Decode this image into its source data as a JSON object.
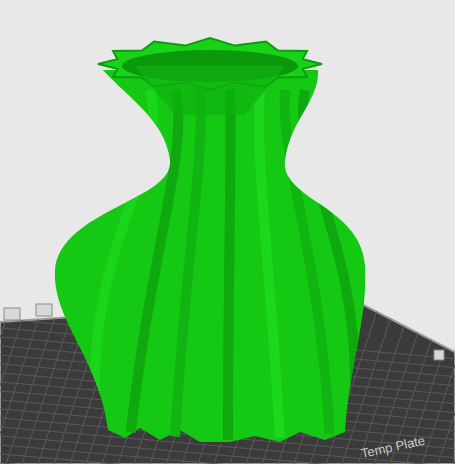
{
  "viewport": {
    "plate_label": "Temp Plate"
  }
}
